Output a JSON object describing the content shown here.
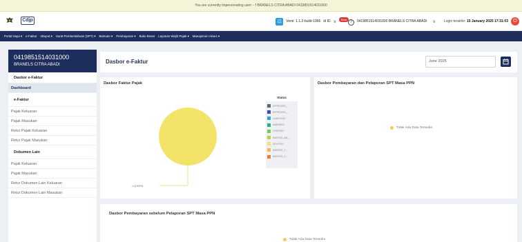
{
  "impersonation_text": "You are currently impersonating user: - f BRANELS CITRA ABADI 0419851514031000",
  "header": {
    "brand": "Cdjp",
    "version": "Versi: 1.1.2-build-1966",
    "language": "id ID",
    "badge": "Beta",
    "taxpayer": "0419851514031000 BRANELS CITRA ABADI",
    "login_label": "Login terakhir:",
    "login_time": "15 January 2025 17:31:03"
  },
  "nav": [
    "Portal Saya ▾",
    "e-Faktur",
    "eBupot ▾",
    "Surat Pemberitahuan (SPT) ▾",
    "Bantuan ▾",
    "Pembayaran ▾",
    "Buku Besar",
    "Layanan Wajib Pajak ▾",
    "Manajemen Akses ▾"
  ],
  "sidebar": {
    "npwp": "0419851514031000",
    "name": "BRANELS CITRA ABADI",
    "section": "Dasbor e-Faktur",
    "dashboard": "Dashboard",
    "group1": "e-Faktur",
    "items1": [
      "Pajak Keluaran",
      "Pajak Masukan",
      "Retur Pajak Keluaran",
      "Retur Pajak Masukan"
    ],
    "group2": "Dokumen Lain",
    "items2": [
      "Pajak Keluaran",
      "Pajak Masukan",
      "Retur Dokumen Lain Keluaran",
      "Retur Dokumen Lain Masukan"
    ]
  },
  "main": {
    "title": "Dasbor e-Faktur",
    "period": "June 2025"
  },
  "panels": {
    "faktur_title": "Dasbor Faktur Pajak",
    "payment_title": "Dasbor Pembayaran dan Pelaporan SPT Masa PPN",
    "payment_before_title": "Dasbor Pembayaran sebelum Pelaporan SPT Masa PPN",
    "no_data": "Tidak Ada Data Tersedia",
    "no_data2": "Tidak Ada Data Tersedia"
  },
  "chart_data": {
    "type": "pie",
    "legend_title": "Status",
    "series": [
      {
        "name": "APPROVED_...",
        "color": "#5a6778"
      },
      {
        "name": "APPROVED_...",
        "color": "#3a4ec0"
      },
      {
        "name": "CANCELED",
        "color": "#2aa3e0"
      },
      {
        "name": "AMENDED",
        "color": "#26b07a"
      },
      {
        "name": "CREATED",
        "color": "#6cd04a"
      },
      {
        "name": "WAITING_AM...",
        "color": "#b8d33b"
      },
      {
        "name": "DELETED",
        "color": "#f3e36b"
      },
      {
        "name": "WAITING_T...",
        "color": "#f5b94a"
      },
      {
        "name": "WAITING_C...",
        "color": "#f07a2c"
      }
    ],
    "values": [
      0,
      0,
      0,
      0,
      0,
      0,
      1,
      0,
      0
    ],
    "label": "1 (100%)"
  }
}
